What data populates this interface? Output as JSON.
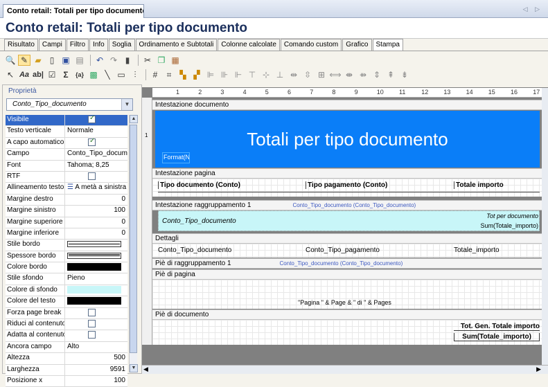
{
  "window": {
    "tab_title": "Conto retail: Totali per tipo documento",
    "nav": "◁ ▷"
  },
  "title": "Conto retail: Totali per tipo documento",
  "tabs": [
    "Risultato",
    "Campi",
    "Filtro",
    "Info",
    "Soglia",
    "Ordinamento e Subtotali",
    "Colonne calcolate",
    "Comando custom",
    "Grafico",
    "Stampa"
  ],
  "active_tab": "Stampa",
  "properties": {
    "group_label": "Proprietà",
    "selected_object": "Conto_Tipo_documento",
    "rows": [
      {
        "k": "Visibile",
        "v": "",
        "type": "check",
        "on": true,
        "selected": true
      },
      {
        "k": "Testo verticale",
        "v": "Normale"
      },
      {
        "k": "A capo automatico",
        "v": "",
        "type": "check",
        "on": true
      },
      {
        "k": "Campo",
        "v": "Conto_Tipo_documento"
      },
      {
        "k": "Font",
        "v": "Tahoma; 8,25"
      },
      {
        "k": "RTF",
        "v": "",
        "type": "check",
        "on": false
      },
      {
        "k": "Allineamento testo",
        "v": "A metà a sinistra",
        "type": "align"
      },
      {
        "k": "Margine destro",
        "v": "0",
        "num": true
      },
      {
        "k": "Margine sinistro",
        "v": "100",
        "num": true
      },
      {
        "k": "Margine superiore",
        "v": "0",
        "num": true
      },
      {
        "k": "Margine inferiore",
        "v": "0",
        "num": true
      },
      {
        "k": "Stile bordo",
        "v": "",
        "type": "line"
      },
      {
        "k": "Spessore bordo",
        "v": "",
        "type": "dline"
      },
      {
        "k": "Colore bordo",
        "v": "",
        "type": "color",
        "color": "#000000"
      },
      {
        "k": "Stile sfondo",
        "v": "Pieno"
      },
      {
        "k": "Colore di sfondo",
        "v": "",
        "type": "color",
        "color": "#c8f6f8"
      },
      {
        "k": "Colore del testo",
        "v": "",
        "type": "color",
        "color": "#000000"
      },
      {
        "k": "Forza page break",
        "v": "",
        "type": "check",
        "on": false
      },
      {
        "k": "Riduci al contenuto",
        "v": "",
        "type": "check",
        "on": false
      },
      {
        "k": "Adatta al contenuto",
        "v": "",
        "type": "check",
        "on": false
      },
      {
        "k": "Ancora campo",
        "v": "Alto"
      },
      {
        "k": "Altezza",
        "v": "500",
        "num": true
      },
      {
        "k": "Larghezza",
        "v": "9591",
        "num": true
      },
      {
        "k": "Posizione x",
        "v": "100",
        "num": true
      }
    ]
  },
  "ruler": [
    "1",
    "2",
    "3",
    "4",
    "5",
    "6",
    "7",
    "8",
    "9",
    "10",
    "11",
    "12",
    "13",
    "14",
    "15",
    "16",
    "17"
  ],
  "report": {
    "sec_header": "Intestazione documento",
    "big_title": "Totali per tipo documento",
    "format_field": "Format(Now,",
    "sec_page_header": "Intestazione pagina",
    "col1": "Tipo documento (Conto)",
    "col2": "Tipo pagamento (Conto)",
    "col3": "Totale importo",
    "sec_group_header": "Intestazione raggruppamento 1",
    "group_ref": "Conto_Tipo_documento (Conto_Tipo_documento)",
    "group_field": "Conto_Tipo_documento",
    "tot_per_doc": "Tot per documento",
    "sum1": "Sum(Totale_importo)",
    "sec_detail": "Dettagli",
    "d1": "Conto_Tipo_documento",
    "d2": "Conto_Tipo_pagamento",
    "d3": "Totale_importo",
    "sec_group_footer": "Piè di raggruppamento 1",
    "group_ref2": "Conto_Tipo_documento (Conto_Tipo_documento)",
    "sec_page_footer": "Piè di pagina",
    "page_expr": "\"Pagina \" & Page & \" di \" & Pages",
    "sec_doc_footer": "Piè di documento",
    "grand_total": "Tot. Gen. Totale importo",
    "sum2": "Sum(Totale_importo)"
  },
  "colors": {
    "title_band": "#0a7ef8",
    "group_band": "#c8f6f8",
    "selection": "#3168c8"
  }
}
